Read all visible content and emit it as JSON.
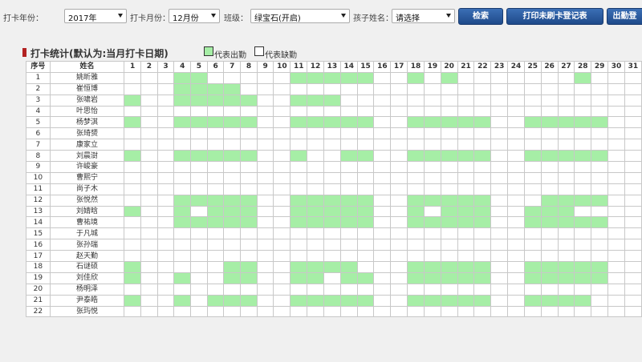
{
  "filters": {
    "year_label": "打卡年份：",
    "year_value": "2017年",
    "month_label": "打卡月份：",
    "month_value": "12月份",
    "class_label": "班级：",
    "class_value": "绿宝石(开启)",
    "child_label": "孩子姓名：",
    "child_value": "请选择"
  },
  "buttons": {
    "search": "检索",
    "print": "打印未刷卡登记表",
    "attendance": "出勤登"
  },
  "section": {
    "title": "打卡统计(默认为:当月打卡日期)",
    "legend_present": "代表出勤",
    "legend_absent": "代表缺勤"
  },
  "colors": {
    "present": "#a6eea6",
    "title_marker": "#b22222",
    "button": "#2a5a9e"
  },
  "table": {
    "header_no": "序号",
    "header_name": "姓名",
    "days": [
      "1",
      "2",
      "3",
      "4",
      "5",
      "6",
      "7",
      "8",
      "9",
      "10",
      "11",
      "12",
      "13",
      "14",
      "15",
      "16",
      "17",
      "18",
      "19",
      "20",
      "21",
      "22",
      "23",
      "24",
      "25",
      "26",
      "27",
      "28",
      "29",
      "30",
      "31"
    ],
    "rows": [
      {
        "no": "1",
        "name": "姚昕雅",
        "present": [
          4,
          5,
          11,
          12,
          13,
          14,
          15,
          18,
          20,
          28
        ]
      },
      {
        "no": "2",
        "name": "崔恒博",
        "present": [
          4,
          5,
          6,
          7
        ]
      },
      {
        "no": "3",
        "name": "张啸岩",
        "present": [
          1,
          4,
          5,
          6,
          7,
          8,
          11,
          12,
          13
        ]
      },
      {
        "no": "4",
        "name": "叶思怡",
        "present": []
      },
      {
        "no": "5",
        "name": "杨梦淇",
        "present": [
          1,
          4,
          5,
          6,
          7,
          8,
          11,
          12,
          13,
          14,
          15,
          18,
          19,
          20,
          21,
          22,
          25,
          26,
          27,
          28,
          29
        ]
      },
      {
        "no": "6",
        "name": "张琦赟",
        "present": []
      },
      {
        "no": "7",
        "name": "康家立",
        "present": []
      },
      {
        "no": "8",
        "name": "刘晨澍",
        "present": [
          1,
          4,
          5,
          6,
          7,
          8,
          11,
          14,
          15,
          18,
          19,
          20,
          21,
          22,
          25,
          26,
          27,
          28,
          29
        ]
      },
      {
        "no": "9",
        "name": "许峻豪",
        "present": []
      },
      {
        "no": "10",
        "name": "曹熙宁",
        "present": []
      },
      {
        "no": "11",
        "name": "尚子木",
        "present": []
      },
      {
        "no": "12",
        "name": "张悦然",
        "present": [
          4,
          5,
          6,
          7,
          8,
          11,
          12,
          13,
          14,
          15,
          18,
          19,
          20,
          21,
          22,
          26,
          27,
          28,
          29
        ]
      },
      {
        "no": "13",
        "name": "刘婧晗",
        "present": [
          1,
          4,
          6,
          7,
          8,
          11,
          12,
          13,
          14,
          15,
          18,
          20,
          21,
          22,
          25,
          26,
          27
        ]
      },
      {
        "no": "14",
        "name": "曹祐境",
        "present": [
          4,
          5,
          6,
          7,
          8,
          11,
          12,
          13,
          14,
          15,
          18,
          19,
          20,
          21,
          22,
          25,
          26,
          27,
          28,
          29
        ]
      },
      {
        "no": "15",
        "name": "于凡城",
        "present": []
      },
      {
        "no": "16",
        "name": "张孙瑞",
        "present": []
      },
      {
        "no": "17",
        "name": "赵天勤",
        "present": []
      },
      {
        "no": "18",
        "name": "石谜硕",
        "present": [
          1,
          7,
          8,
          11,
          12,
          13,
          14,
          18,
          19,
          20,
          21,
          22,
          25,
          26,
          27,
          28,
          29
        ]
      },
      {
        "no": "19",
        "name": "刘佳欣",
        "present": [
          1,
          4,
          7,
          8,
          11,
          12,
          14,
          15,
          18,
          19,
          20,
          21,
          22,
          25,
          26,
          27,
          28,
          29
        ]
      },
      {
        "no": "20",
        "name": "杨明泽",
        "present": []
      },
      {
        "no": "21",
        "name": "尹泰皓",
        "present": [
          1,
          4,
          6,
          7,
          8,
          11,
          12,
          13,
          14,
          15,
          18,
          19,
          20,
          21,
          22,
          25,
          26,
          27,
          28
        ]
      },
      {
        "no": "22",
        "name": "张玙悦",
        "present": []
      }
    ]
  }
}
